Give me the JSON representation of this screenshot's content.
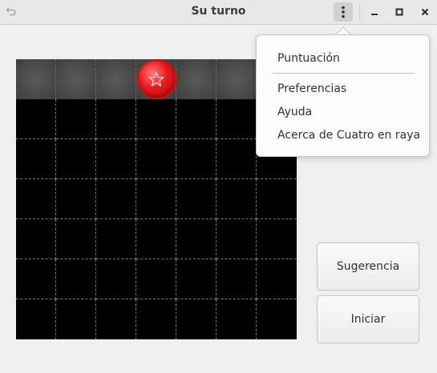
{
  "window": {
    "title": "Su turno"
  },
  "headerbar": {
    "undo_icon": "undo-icon",
    "menu_icon": "vertical-dots-icon",
    "minimize_icon": "minimize-icon",
    "maximize_icon": "maximize-icon",
    "close_icon": "close-icon"
  },
  "board": {
    "columns": 7,
    "rows": 6,
    "current_chip_color": "#e8191c",
    "chip_icon": "star-icon"
  },
  "buttons": {
    "hint_label": "Sugerencia",
    "start_label": "Iniciar"
  },
  "menu": {
    "items": [
      {
        "label": "Puntuación"
      },
      {
        "label": "Preferencias"
      },
      {
        "label": "Ayuda"
      },
      {
        "label": "Acerca de Cuatro en raya"
      }
    ]
  }
}
